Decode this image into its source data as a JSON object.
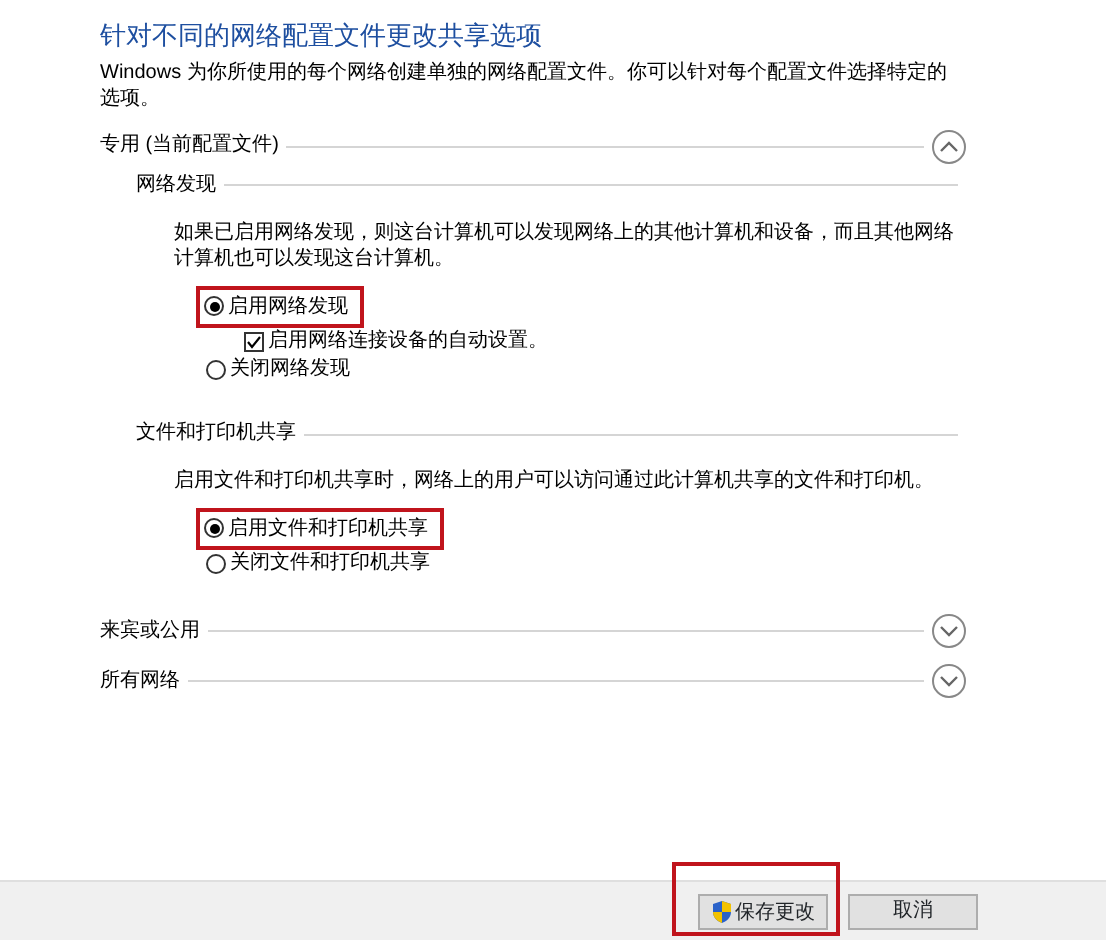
{
  "title": "针对不同的网络配置文件更改共享选项",
  "description": "Windows 为你所使用的每个网络创建单独的网络配置文件。你可以针对每个配置文件选择特定的选项。",
  "profiles": [
    {
      "label": "专用 (当前配置文件)",
      "expanded": true,
      "groups": [
        {
          "heading": "网络发现",
          "text": "如果已启用网络发现，则这台计算机可以发现网络上的其他计算机和设备，而且其他网络计算机也可以发现这台计算机。",
          "options": [
            {
              "kind": "radio",
              "label": "启用网络发现",
              "selected": true,
              "highlighted": true
            },
            {
              "kind": "checkbox",
              "label": "启用网络连接设备的自动设置。",
              "checked": true
            },
            {
              "kind": "radio",
              "label": "关闭网络发现",
              "selected": false,
              "highlighted": false
            }
          ]
        },
        {
          "heading": "文件和打印机共享",
          "text": "启用文件和打印机共享时，网络上的用户可以访问通过此计算机共享的文件和打印机。",
          "options": [
            {
              "kind": "radio",
              "label": "启用文件和打印机共享",
              "selected": true,
              "highlighted": true
            },
            {
              "kind": "radio",
              "label": "关闭文件和打印机共享",
              "selected": false,
              "highlighted": false
            }
          ]
        }
      ]
    },
    {
      "label": "来宾或公用",
      "expanded": false
    },
    {
      "label": "所有网络",
      "expanded": false
    }
  ],
  "buttons": [
    {
      "label": "保存更改",
      "kind": "shield",
      "highlighted": true
    },
    {
      "label": "取消",
      "kind": "plain",
      "highlighted": false
    }
  ]
}
